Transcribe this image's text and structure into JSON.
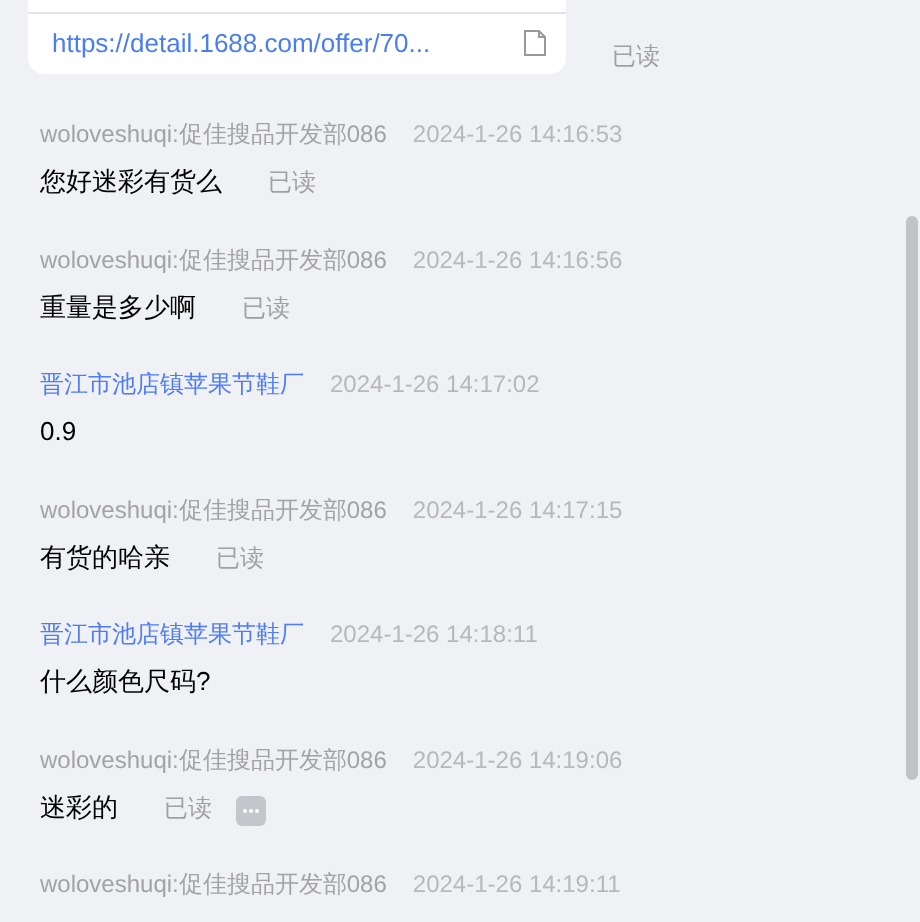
{
  "link_card": {
    "url": "https://detail.1688.com/offer/70...",
    "read_label": "已读"
  },
  "messages": [
    {
      "sender": "woloveshuqi:促佳搜品开发部086",
      "kind": "self",
      "time": "2024-1-26 14:16:53",
      "text": "您好迷彩有货么",
      "read_label": "已读"
    },
    {
      "sender": "woloveshuqi:促佳搜品开发部086",
      "kind": "self",
      "time": "2024-1-26 14:16:56",
      "text": "重量是多少啊",
      "read_label": "已读"
    },
    {
      "sender": "晋江市池店镇苹果节鞋厂",
      "kind": "other",
      "time": "2024-1-26 14:17:02",
      "text": "0.9"
    },
    {
      "sender": "woloveshuqi:促佳搜品开发部086",
      "kind": "self",
      "time": "2024-1-26 14:17:15",
      "text": "有货的哈亲",
      "read_label": "已读"
    },
    {
      "sender": "晋江市池店镇苹果节鞋厂",
      "kind": "other",
      "time": "2024-1-26 14:18:11",
      "text": "什么颜色尺码?"
    },
    {
      "sender": "woloveshuqi:促佳搜品开发部086",
      "kind": "self",
      "time": "2024-1-26 14:19:06",
      "text": "迷彩的",
      "read_label": "已读",
      "has_menu": true
    },
    {
      "sender": "woloveshuqi:促佳搜品开发部086",
      "kind": "self",
      "time": "2024-1-26 14:19:11"
    }
  ]
}
